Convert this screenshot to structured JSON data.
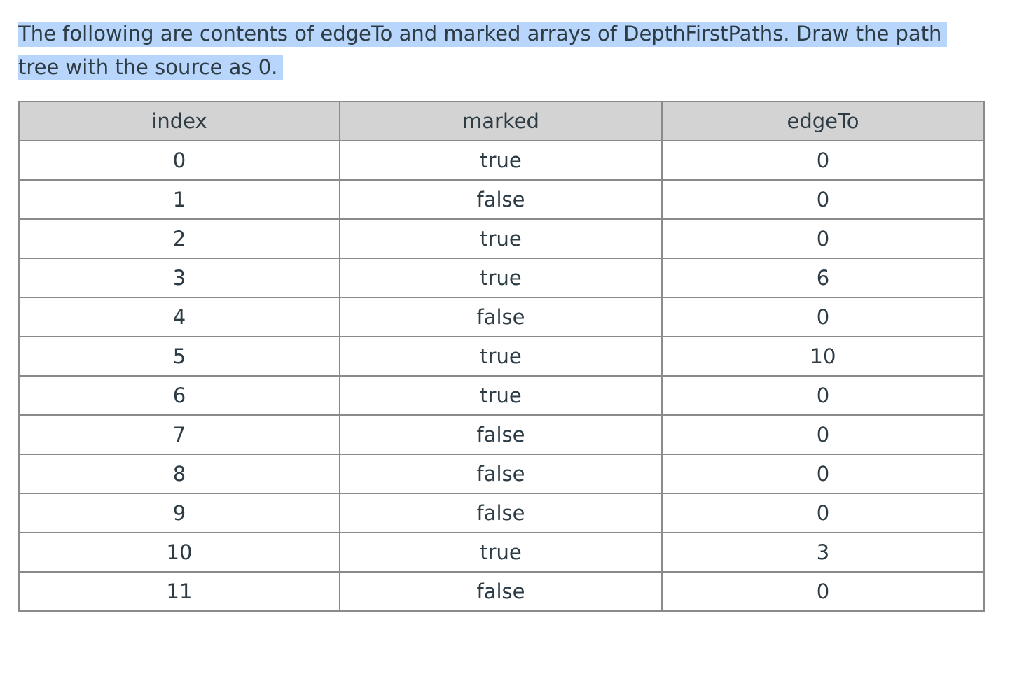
{
  "question": {
    "text": "The following are contents of edgeTo and marked arrays of DepthFirstPaths.  Draw the path tree with the source as 0."
  },
  "table": {
    "headers": [
      "index",
      "marked",
      "edgeTo"
    ],
    "rows": [
      [
        "0",
        "true",
        "0"
      ],
      [
        "1",
        "false",
        "0"
      ],
      [
        "2",
        "true",
        "0"
      ],
      [
        "3",
        "true",
        "6"
      ],
      [
        "4",
        "false",
        "0"
      ],
      [
        "5",
        "true",
        "10"
      ],
      [
        "6",
        "true",
        "0"
      ],
      [
        "7",
        "false",
        "0"
      ],
      [
        "8",
        "false",
        "0"
      ],
      [
        "9",
        "false",
        "0"
      ],
      [
        "10",
        "true",
        "3"
      ],
      [
        "11",
        "false",
        "0"
      ]
    ]
  },
  "colors": {
    "selection_highlight": "#b8d6fb",
    "header_background": "#d3d3d3",
    "border": "#8a8a8a",
    "text": "#2d3b45"
  }
}
